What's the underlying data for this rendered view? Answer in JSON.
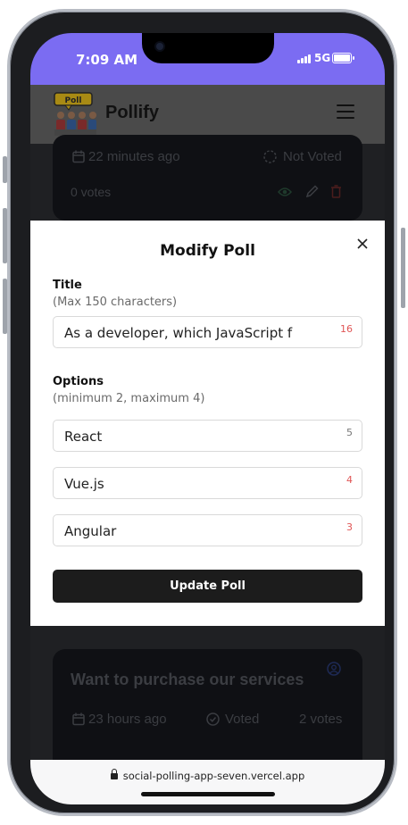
{
  "status_bar": {
    "time": "7:09 AM",
    "network": "5G",
    "background_color": "#7b6cf2"
  },
  "app": {
    "brand": "Pollify",
    "logo_icon": "pollify-logo-icon",
    "menu_icon": "hamburger-menu-icon"
  },
  "background_cards": [
    {
      "time_ago": "22 minutes ago",
      "vote_status": "Not Voted",
      "votes": "0 votes",
      "actions": [
        "eye-icon",
        "pencil-icon",
        "trash-icon"
      ]
    },
    {
      "title": "Want to purchase our services",
      "time_ago": "23 hours ago",
      "vote_status": "Voted",
      "votes": "2 votes"
    }
  ],
  "modal": {
    "title": "Modify Poll",
    "close_icon": "close-icon",
    "title_field": {
      "label": "Title",
      "hint": "(Max 150 characters)",
      "value": "As a developer, which JavaScript f",
      "counter": "16"
    },
    "options_section": {
      "label": "Options",
      "hint": "(minimum 2, maximum 4)"
    },
    "options": [
      {
        "value": "React",
        "counter": "5",
        "counter_color": "#777777"
      },
      {
        "value": "Vue.js",
        "counter": "4",
        "counter_color": "#e05555"
      },
      {
        "value": "Angular",
        "counter": "3",
        "counter_color": "#e05555"
      }
    ],
    "submit_label": "Update Poll"
  },
  "browser": {
    "url": "social-polling-app-seven.vercel.app",
    "lock_icon": "lock-icon"
  }
}
